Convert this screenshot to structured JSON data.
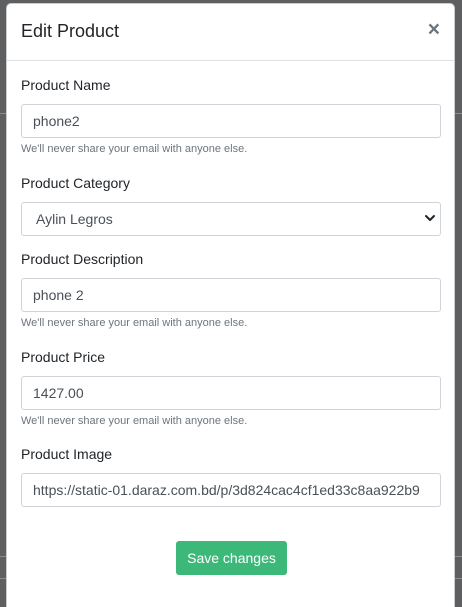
{
  "modal": {
    "title": "Edit Product",
    "close_glyph": "×"
  },
  "form": {
    "name": {
      "label": "Product Name",
      "value": "phone2",
      "help": "We'll never share your email with anyone else."
    },
    "category": {
      "label": "Product Category",
      "selected": "Aylin Legros"
    },
    "description": {
      "label": "Product Description",
      "value": "phone 2",
      "help": "We'll never share your email with anyone else."
    },
    "price": {
      "label": "Product Price",
      "value": "1427.00",
      "help": "We'll never share your email with anyone else."
    },
    "image": {
      "label": "Product Image",
      "value": "https://static-01.daraz.com.bd/p/3d824cac4cf1ed33c8aa922b9"
    }
  },
  "footer": {
    "save_label": "Save changes"
  },
  "colors": {
    "save_button": "#3cb878"
  }
}
